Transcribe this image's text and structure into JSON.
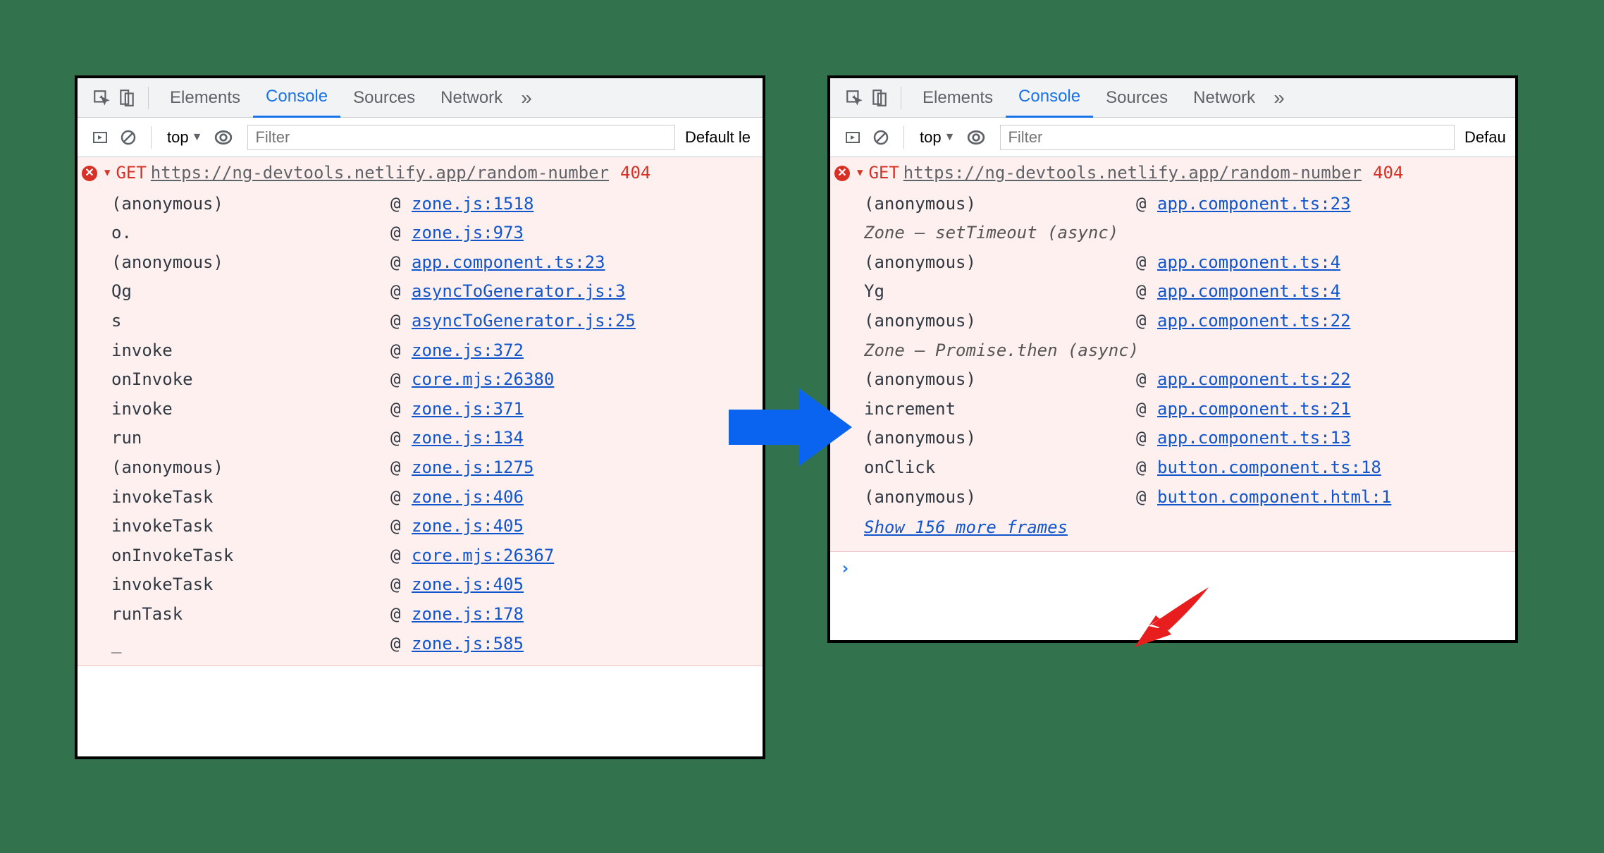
{
  "tabs": {
    "elements": "Elements",
    "console": "Console",
    "sources": "Sources",
    "network": "Network"
  },
  "toolbar": {
    "top": "top",
    "filter_placeholder": "Filter",
    "level_left": "Default le",
    "level_right": "Defau"
  },
  "error": {
    "method": "GET",
    "url": "https://ng-devtools.netlify.app/random-number",
    "status": "404"
  },
  "left_frames": [
    {
      "fn": "(anonymous)",
      "loc": "zone.js:1518"
    },
    {
      "fn": "o.<computed>",
      "loc": "zone.js:973"
    },
    {
      "fn": "(anonymous)",
      "loc": "app.component.ts:23"
    },
    {
      "fn": "Qg",
      "loc": "asyncToGenerator.js:3"
    },
    {
      "fn": "s",
      "loc": "asyncToGenerator.js:25"
    },
    {
      "fn": "invoke",
      "loc": "zone.js:372"
    },
    {
      "fn": "onInvoke",
      "loc": "core.mjs:26380"
    },
    {
      "fn": "invoke",
      "loc": "zone.js:371"
    },
    {
      "fn": "run",
      "loc": "zone.js:134"
    },
    {
      "fn": "(anonymous)",
      "loc": "zone.js:1275"
    },
    {
      "fn": "invokeTask",
      "loc": "zone.js:406"
    },
    {
      "fn": "invokeTask",
      "loc": "zone.js:405"
    },
    {
      "fn": "onInvokeTask",
      "loc": "core.mjs:26367"
    },
    {
      "fn": "invokeTask",
      "loc": "zone.js:405"
    },
    {
      "fn": "runTask",
      "loc": "zone.js:178"
    },
    {
      "fn": "_",
      "loc": "zone.js:585"
    }
  ],
  "right_groups": [
    {
      "kind": "frame",
      "fn": "(anonymous)",
      "loc": "app.component.ts:23"
    },
    {
      "kind": "label",
      "text": "Zone — setTimeout (async)"
    },
    {
      "kind": "frame",
      "fn": "(anonymous)",
      "loc": "app.component.ts:4"
    },
    {
      "kind": "frame",
      "fn": "Yg",
      "loc": "app.component.ts:4"
    },
    {
      "kind": "frame",
      "fn": "(anonymous)",
      "loc": "app.component.ts:22"
    },
    {
      "kind": "label",
      "text": "Zone — Promise.then (async)"
    },
    {
      "kind": "frame",
      "fn": "(anonymous)",
      "loc": "app.component.ts:22"
    },
    {
      "kind": "frame",
      "fn": "increment",
      "loc": "app.component.ts:21"
    },
    {
      "kind": "frame",
      "fn": "(anonymous)",
      "loc": "app.component.ts:13"
    },
    {
      "kind": "frame",
      "fn": "onClick",
      "loc": "button.component.ts:18"
    },
    {
      "kind": "frame",
      "fn": "(anonymous)",
      "loc": "button.component.html:1"
    }
  ],
  "show_more": "Show 156 more frames"
}
